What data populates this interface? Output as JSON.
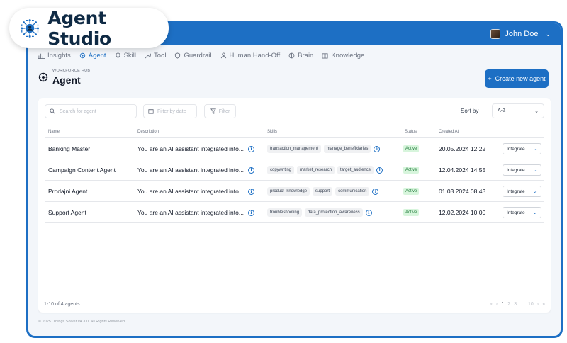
{
  "brand": {
    "name": "Agent Studio"
  },
  "topbar": {
    "user_name": "John Doe"
  },
  "nav": {
    "items": [
      {
        "label": "Insights"
      },
      {
        "label": "Agent"
      },
      {
        "label": "Skill"
      },
      {
        "label": "Tool"
      },
      {
        "label": "Guardrail"
      },
      {
        "label": "Human Hand-Off"
      },
      {
        "label": "Brain"
      },
      {
        "label": "Knowledge"
      }
    ]
  },
  "header": {
    "breadcrumb": "WORKFORCE HUB",
    "title": "Agent",
    "create_label": "Create new agent"
  },
  "toolbar": {
    "search_placeholder": "Search for agent",
    "date_placeholder": "Filter by date",
    "filter_label": "Filter",
    "sort_label": "Sort by",
    "sort_value": "A-Z"
  },
  "table": {
    "columns": [
      "Name",
      "Description",
      "Skills",
      "Status",
      "Created At"
    ],
    "rows": [
      {
        "name": "Banking Master",
        "description": "You are an AI assistant integrated into...",
        "skills": [
          "transaction_management",
          "manage_beneficiaries"
        ],
        "status": "Active",
        "created": "20.05.2024 12:22",
        "action": "Integrate"
      },
      {
        "name": "Campaign Content Agent",
        "description": "You are an AI assistant integrated into...",
        "skills": [
          "copywriting",
          "market_research",
          "target_audience"
        ],
        "status": "Active",
        "created": "12.04.2024 14:55",
        "action": "Integrate"
      },
      {
        "name": "Prodajni Agent",
        "description": "You are an AI assistant integrated into...",
        "skills": [
          "product_knowledge",
          "support",
          "communication"
        ],
        "status": "Active",
        "created": "01.03.2024 08:43",
        "action": "Integrate"
      },
      {
        "name": "Support Agent",
        "description": "You are an AI assistant integrated into...",
        "skills": [
          "troubleshooting",
          "data_protection_awareness"
        ],
        "status": "Active",
        "created": "12.02.2024 10:00",
        "action": "Integrate"
      }
    ]
  },
  "pagination": {
    "count_text": "1-10 of 4 agents",
    "pages": [
      "1",
      "2",
      "3",
      "...",
      "10"
    ]
  },
  "footer": {
    "text": "© 2025. Things Solver v4.3.0. All Rights Reserved"
  },
  "colors": {
    "primary": "#1d6fc4",
    "active_badge_bg": "#d7f5dc",
    "active_badge_text": "#1f7a3a"
  }
}
